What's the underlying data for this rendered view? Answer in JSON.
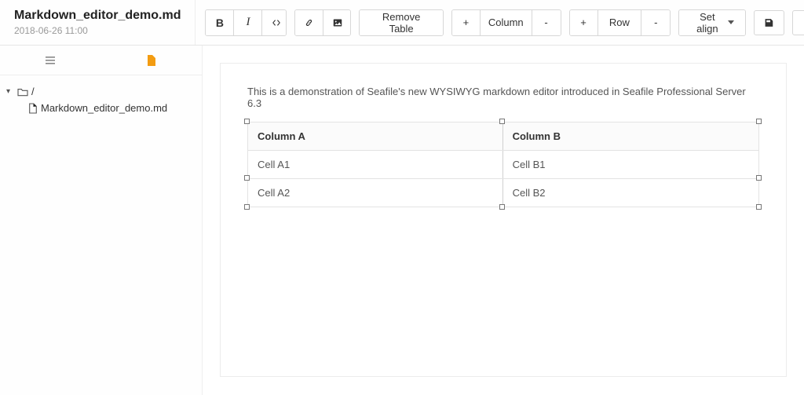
{
  "header": {
    "title": "Markdown_editor_demo.md",
    "timestamp": "2018-06-26 11:00"
  },
  "toolbar": {
    "remove_table": "Remove Table",
    "column": "Column",
    "row": "Row",
    "set_align": "Set align",
    "plus": "+",
    "minus": "-"
  },
  "sidebar": {
    "root_label": "/",
    "file_label": "Markdown_editor_demo.md"
  },
  "editor": {
    "intro": "This is a demonstration of Seafile's new WYSIWYG markdown editor introduced in Seafile Professional Server 6.3",
    "table": {
      "headers": [
        "Column A",
        "Column B"
      ],
      "rows": [
        [
          "Cell A1",
          "Cell B1"
        ],
        [
          "Cell A2",
          "Cell B2"
        ]
      ]
    }
  }
}
